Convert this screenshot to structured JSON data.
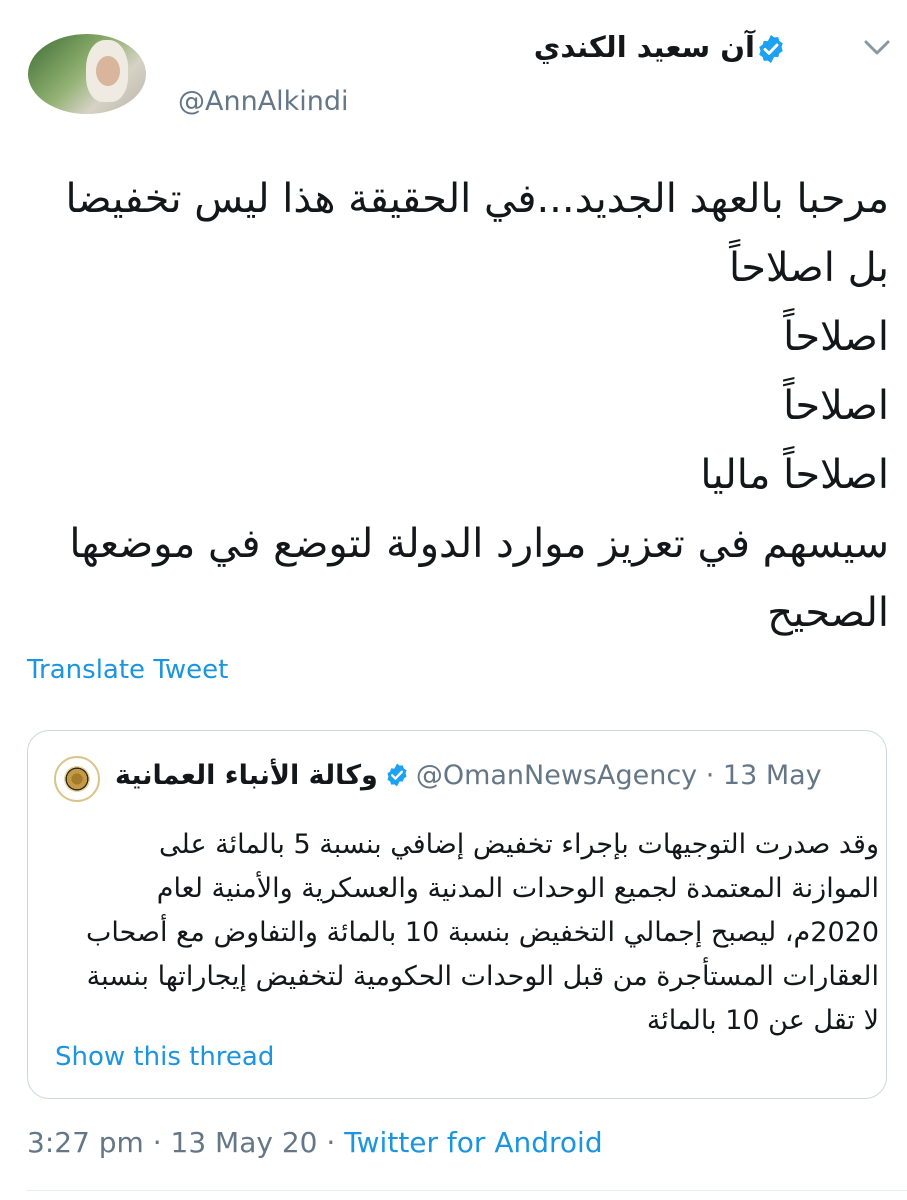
{
  "tweet": {
    "display_name": "آن سعيد الكندي",
    "handle": "@AnnAlkindi",
    "verified": true,
    "text": "مرحبا بالعهد الجديد...في الحقيقة هذا ليس تخفيضا\nبل اصلاحاً\n اصلاحاً\nاصلاحاً\nاصلاحاً ماليا\nسيسهم في تعزيز موارد الدولة لتوضع في موضعها\nالصحيح",
    "translate_label": "Translate Tweet"
  },
  "quoted_tweet": {
    "display_name": "وكالة الأنباء العمانية",
    "handle": "@OmanNewsAgency",
    "separator": " · ",
    "date": "13 May",
    "verified": true,
    "text": "وقد صدرت التوجيهات بإجراء تخفيض إضافي بنسبة 5 بالمائة على\nالموازنة المعتمدة لجميع الوحدات المدنية والعسكرية والأمنية لعام\n2020م، ليصبح إجمالي التخفيض بنسبة 10 بالمائة والتفاوض مع أصحاب\nالعقارات المستأجرة من قبل الوحدات الحكومية لتخفيض  إيجاراتها بنسبة\nلا تقل عن 10 بالمائة",
    "show_thread_label": "Show this thread"
  },
  "footer": {
    "time": "3:27 pm",
    "separator": " · ",
    "date": "13 May 20",
    "source": "Twitter for Android"
  },
  "colors": {
    "accent": "#1b95e0",
    "muted": "#657786",
    "text": "#14171a",
    "border": "#ccd6dd"
  },
  "icons": {
    "verified": "verified-badge-icon",
    "menu": "chevron-down-icon"
  }
}
